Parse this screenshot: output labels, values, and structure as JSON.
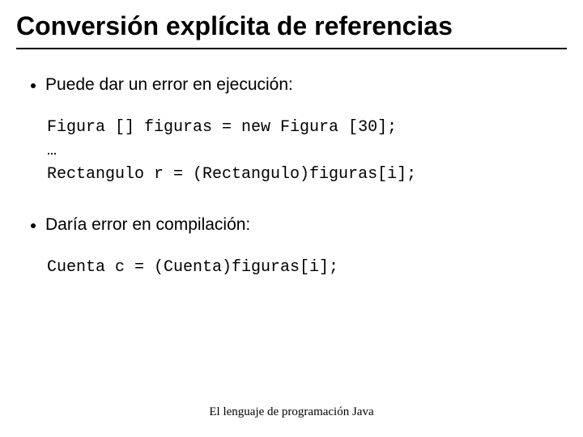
{
  "title": "Conversión explícita de referencias",
  "bullets": {
    "b1": "Puede dar un error en ejecución:",
    "b2": "Daría error en compilación:"
  },
  "code": {
    "block1_line1": "Figura [] figuras = new Figura [30];",
    "block1_line2": "…",
    "block1_line3": "Rectangulo r = (Rectangulo)figuras[i];",
    "block2_line1": "Cuenta c = (Cuenta)figuras[i];"
  },
  "footer": "El lenguaje de programación Java"
}
